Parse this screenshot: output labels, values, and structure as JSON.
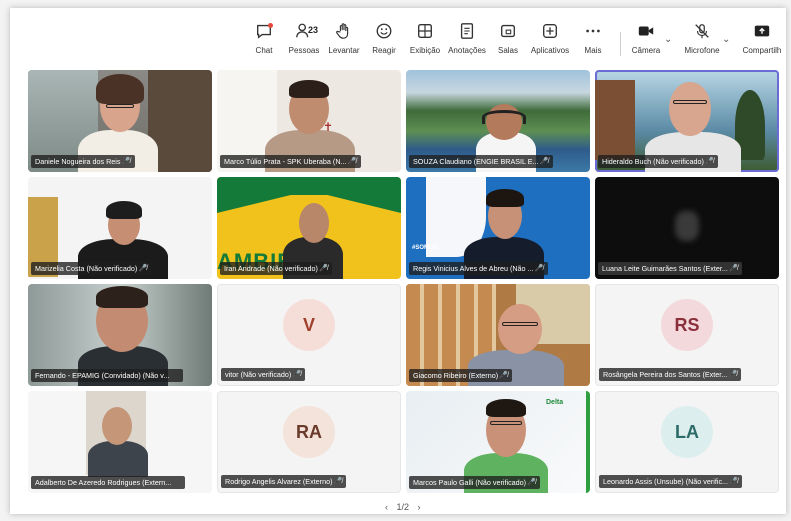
{
  "toolbar": {
    "items": [
      {
        "label": "Chat",
        "icon": "chat-icon"
      },
      {
        "label": "Pessoas",
        "icon": "people-icon",
        "count": "23"
      },
      {
        "label": "Levantar",
        "icon": "raise-hand-icon"
      },
      {
        "label": "Reagir",
        "icon": "smile-icon"
      },
      {
        "label": "Exibição",
        "icon": "view-icon"
      },
      {
        "label": "Anotações",
        "icon": "notes-icon"
      },
      {
        "label": "Salas",
        "icon": "rooms-icon"
      },
      {
        "label": "Aplicativos",
        "icon": "apps-icon"
      },
      {
        "label": "Mais",
        "icon": "more-icon"
      }
    ],
    "camera_label": "Câmera",
    "mic_label": "Microfone",
    "share_label": "Compartilh"
  },
  "participants": [
    {
      "name": "Daniele Nogueira dos Reis",
      "muted": true
    },
    {
      "name": "Marco Túlio Prata - SPK Uberaba (N...",
      "muted": true
    },
    {
      "name": "SOUZA Claudiano (ENGIE BRASIL E...",
      "muted": true
    },
    {
      "name": "Hideraldo Buch (Não verificado)",
      "muted": true
    },
    {
      "name": "Marizelia Costa (Não verificado)",
      "muted": true
    },
    {
      "name": "Iran Andrade (Não verificado)",
      "muted": true
    },
    {
      "name": "Regis Vinicius Alves de Abreu (Não ...",
      "muted": true
    },
    {
      "name": "Luana Leite Guimarães Santos (Exter...",
      "muted": true
    },
    {
      "name": "Fernando - EPAMIG (Convidado) (Não v...",
      "muted": false
    },
    {
      "name": "vitor (Não verificado)",
      "muted": true,
      "initials": "V"
    },
    {
      "name": "Giacomo Ribeiro (Externo)",
      "muted": true
    },
    {
      "name": "Rosângela Pereira dos Santos (Exter...",
      "muted": true,
      "initials": "RS"
    },
    {
      "name": "Adalberto De Azeredo Rodrigues (Extern...",
      "muted": false
    },
    {
      "name": "Rodrigo Angelis Alvarez (Externo)",
      "muted": true,
      "initials": "RA"
    },
    {
      "name": "Marcos Paulo Galli (Não verificado)",
      "muted": true
    },
    {
      "name": "Leonardo Assis (Unsube) (Não verific...",
      "muted": true,
      "initials": "LA"
    }
  ],
  "background_text": {
    "tile6_banner": "AMBIENTE",
    "tile7_banner": "#SOMOS",
    "tile15_logo": "Delta"
  },
  "pager": {
    "label": "1/2",
    "prev": "‹",
    "next": "›"
  },
  "colors": {
    "accent": "#6b6bd6",
    "speaking": "#2e9f3e",
    "chat_badge": "#e2473c"
  }
}
